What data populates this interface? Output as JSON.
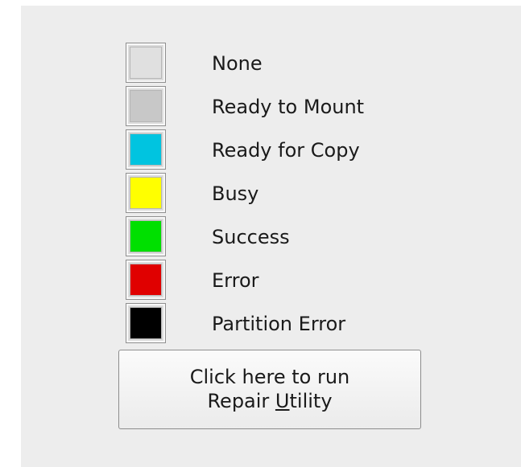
{
  "legend": {
    "items": [
      {
        "label": "None",
        "color": "#e0e0e0"
      },
      {
        "label": "Ready to Mount",
        "color": "#c8c8c8"
      },
      {
        "label": "Ready for Copy",
        "color": "#00c4e0"
      },
      {
        "label": "Busy",
        "color": "#ffff00"
      },
      {
        "label": "Success",
        "color": "#00e000"
      },
      {
        "label": "Error",
        "color": "#e00000"
      },
      {
        "label": "Partition Error",
        "color": "#000000"
      }
    ]
  },
  "repair_button": {
    "line1": "Click here to run",
    "line2_prefix": "Repair ",
    "line2_mnemonic": "U",
    "line2_suffix": "tility"
  }
}
